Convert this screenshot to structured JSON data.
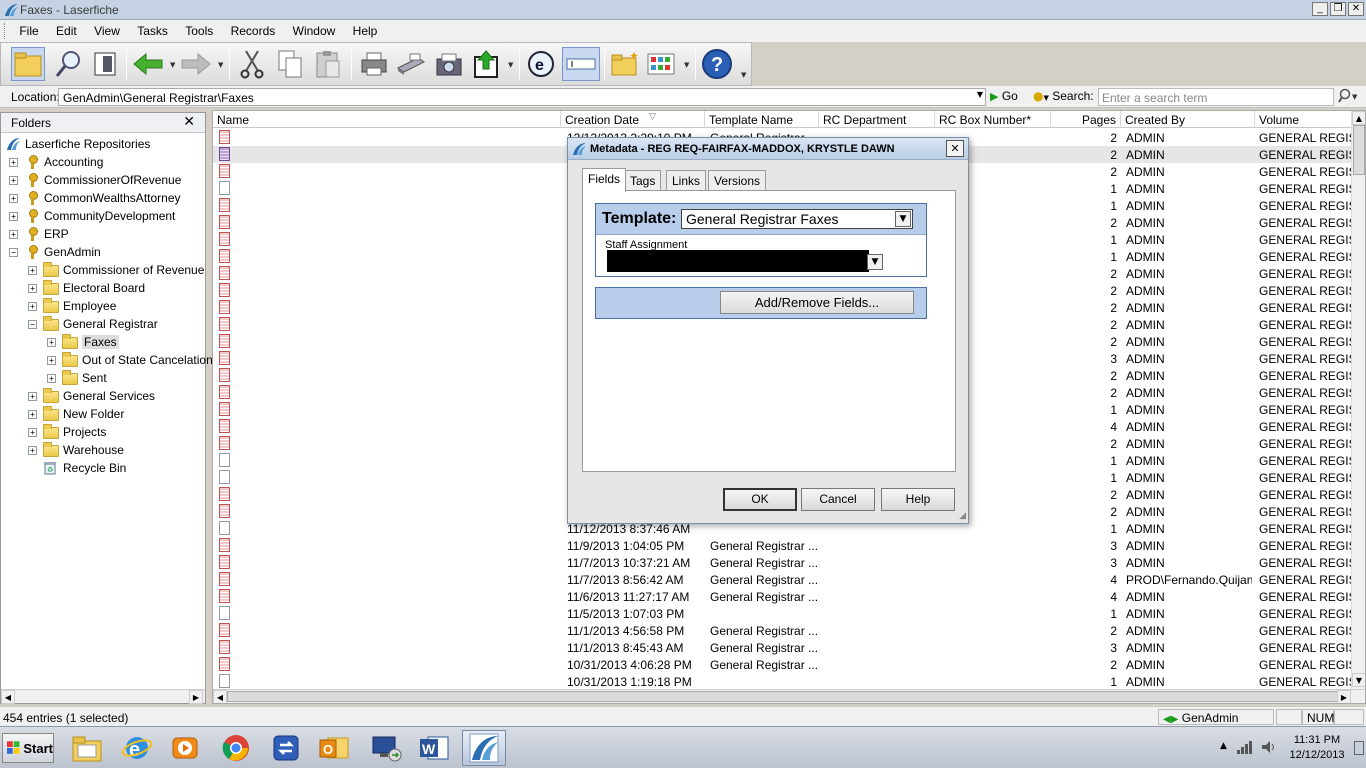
{
  "window": {
    "title": "Faxes - Laserfiche"
  },
  "menu": [
    "File",
    "Edit",
    "View",
    "Tasks",
    "Tools",
    "Records",
    "Window",
    "Help"
  ],
  "location": {
    "label": "Location:",
    "path": "GenAdmin\\General Registrar\\Faxes",
    "go_label": "Go"
  },
  "search": {
    "label": "Search:",
    "placeholder": "Enter a search term"
  },
  "folders": {
    "title": "Folders",
    "close": "✕",
    "root": "Laserfiche Repositories",
    "items": [
      "Accounting",
      "CommissionerOfRevenue",
      "CommonWealthsAttorney",
      "CommunityDevelopment",
      "ERP",
      "GenAdmin",
      "Commissioner of Revenue",
      "Electoral Board",
      "Employee",
      "General Registrar",
      "Faxes",
      "Out of State Cancelations",
      "Sent",
      "General Services",
      "New Folder",
      "Projects",
      "Warehouse",
      "Recycle Bin"
    ]
  },
  "grid": {
    "columns": [
      "Name",
      "Creation Date",
      "Template Name",
      "RC Department",
      "RC Box Number*",
      "Pages",
      "Created By",
      "Volume"
    ],
    "rows": [
      {
        "date": "12/12/2013 2:29:10 PM",
        "tmpl": "General Registrar ...",
        "pages": "2",
        "by": "ADMIN",
        "vol": "GENERAL REGISTR",
        "icon": "pdf"
      },
      {
        "date": "",
        "tmpl": "",
        "pages": "2",
        "by": "ADMIN",
        "vol": "GENERAL REGISTR",
        "icon": "pur"
      },
      {
        "date": "",
        "tmpl": "",
        "pages": "2",
        "by": "ADMIN",
        "vol": "GENERAL REGISTR",
        "icon": "pdf"
      },
      {
        "date": "",
        "tmpl": "",
        "pages": "1",
        "by": "ADMIN",
        "vol": "GENERAL REGISTR",
        "icon": "blank"
      },
      {
        "date": "",
        "tmpl": "",
        "pages": "1",
        "by": "ADMIN",
        "vol": "GENERAL REGISTR",
        "icon": "pdf"
      },
      {
        "date": "",
        "tmpl": "",
        "pages": "2",
        "by": "ADMIN",
        "vol": "GENERAL REGISTR",
        "icon": "pdf"
      },
      {
        "date": "",
        "tmpl": "",
        "pages": "1",
        "by": "ADMIN",
        "vol": "GENERAL REGISTR",
        "icon": "pdf"
      },
      {
        "date": "",
        "tmpl": "",
        "pages": "1",
        "by": "ADMIN",
        "vol": "GENERAL REGISTR",
        "icon": "pdf"
      },
      {
        "date": "",
        "tmpl": "",
        "pages": "2",
        "by": "ADMIN",
        "vol": "GENERAL REGISTR",
        "icon": "pdf"
      },
      {
        "date": "",
        "tmpl": "",
        "pages": "2",
        "by": "ADMIN",
        "vol": "GENERAL REGISTR",
        "icon": "pdf"
      },
      {
        "date": "",
        "tmpl": "",
        "pages": "2",
        "by": "ADMIN",
        "vol": "GENERAL REGISTR",
        "icon": "pdf"
      },
      {
        "date": "",
        "tmpl": "",
        "pages": "2",
        "by": "ADMIN",
        "vol": "GENERAL REGISTR",
        "icon": "pdf"
      },
      {
        "date": "",
        "tmpl": "",
        "pages": "2",
        "by": "ADMIN",
        "vol": "GENERAL REGISTR",
        "icon": "pdf"
      },
      {
        "date": "",
        "tmpl": "",
        "pages": "3",
        "by": "ADMIN",
        "vol": "GENERAL REGISTR",
        "icon": "pdf"
      },
      {
        "date": "",
        "tmpl": "",
        "pages": "2",
        "by": "ADMIN",
        "vol": "GENERAL REGISTR",
        "icon": "pdf"
      },
      {
        "date": "",
        "tmpl": "",
        "pages": "2",
        "by": "ADMIN",
        "vol": "GENERAL REGISTR",
        "icon": "pdf"
      },
      {
        "date": "",
        "tmpl": "",
        "pages": "1",
        "by": "ADMIN",
        "vol": "GENERAL REGISTR",
        "icon": "pdf"
      },
      {
        "date": "",
        "tmpl": "",
        "pages": "4",
        "by": "ADMIN",
        "vol": "GENERAL REGISTR",
        "icon": "pdf"
      },
      {
        "date": "",
        "tmpl": "",
        "pages": "2",
        "by": "ADMIN",
        "vol": "GENERAL REGISTR",
        "icon": "pdf"
      },
      {
        "date": "",
        "tmpl": "",
        "pages": "1",
        "by": "ADMIN",
        "vol": "GENERAL REGISTR",
        "icon": "blank"
      },
      {
        "date": "",
        "tmpl": "",
        "pages": "1",
        "by": "ADMIN",
        "vol": "GENERAL REGISTR",
        "icon": "blank"
      },
      {
        "date": "",
        "tmpl": "",
        "pages": "2",
        "by": "ADMIN",
        "vol": "GENERAL REGISTR",
        "icon": "pdf"
      },
      {
        "date": "",
        "tmpl": "",
        "pages": "2",
        "by": "ADMIN",
        "vol": "GENERAL REGISTR",
        "icon": "pdf"
      },
      {
        "date": "11/12/2013 8:37:46 AM",
        "tmpl": "",
        "pages": "1",
        "by": "ADMIN",
        "vol": "GENERAL REGISTR",
        "icon": "blank"
      },
      {
        "date": "11/9/2013 1:04:05 PM",
        "tmpl": "General Registrar ...",
        "pages": "3",
        "by": "ADMIN",
        "vol": "GENERAL REGISTR",
        "icon": "pdf"
      },
      {
        "date": "11/7/2013 10:37:21 AM",
        "tmpl": "General Registrar ...",
        "pages": "3",
        "by": "ADMIN",
        "vol": "GENERAL REGISTR",
        "icon": "pdf"
      },
      {
        "date": "11/7/2013 8:56:42 AM",
        "tmpl": "General Registrar ...",
        "pages": "4",
        "by": "PROD\\Fernando.Quijano",
        "vol": "GENERAL REGISTR",
        "icon": "pdf"
      },
      {
        "date": "11/6/2013 11:27:17 AM",
        "tmpl": "General Registrar ...",
        "pages": "4",
        "by": "ADMIN",
        "vol": "GENERAL REGISTR",
        "icon": "pdf"
      },
      {
        "date": "11/5/2013 1:07:03 PM",
        "tmpl": "",
        "pages": "1",
        "by": "ADMIN",
        "vol": "GENERAL REGISTR",
        "icon": "blank"
      },
      {
        "date": "11/1/2013 4:56:58 PM",
        "tmpl": "General Registrar ...",
        "pages": "2",
        "by": "ADMIN",
        "vol": "GENERAL REGISTR",
        "icon": "pdf"
      },
      {
        "date": "11/1/2013 8:45:43 AM",
        "tmpl": "General Registrar ...",
        "pages": "3",
        "by": "ADMIN",
        "vol": "GENERAL REGISTR",
        "icon": "pdf"
      },
      {
        "date": "10/31/2013 4:06:28 PM",
        "tmpl": "General Registrar ...",
        "pages": "2",
        "by": "ADMIN",
        "vol": "GENERAL REGISTR",
        "icon": "pdf"
      },
      {
        "date": "10/31/2013 1:19:18 PM",
        "tmpl": "",
        "pages": "1",
        "by": "ADMIN",
        "vol": "GENERAL REGISTR",
        "icon": "blank"
      }
    ]
  },
  "status": {
    "entries": "454 entries (1 selected)",
    "repo": "GenAdmin (ADMIN)",
    "num": "NUM"
  },
  "taskbar": {
    "start": "Start",
    "time": "11:31 PM",
    "date": "12/12/2013"
  },
  "dialog": {
    "title": "Metadata - REG REQ-FAIRFAX-MADDOX, KRYSTLE DAWN",
    "tabs": [
      "Fields",
      "Tags",
      "Links",
      "Versions"
    ],
    "template_label": "Template:",
    "template_value": "General Registrar Faxes",
    "staff_label": "Staff Assignment",
    "add_remove": "Add/Remove Fields...",
    "ok": "OK",
    "cancel": "Cancel",
    "help": "Help"
  }
}
